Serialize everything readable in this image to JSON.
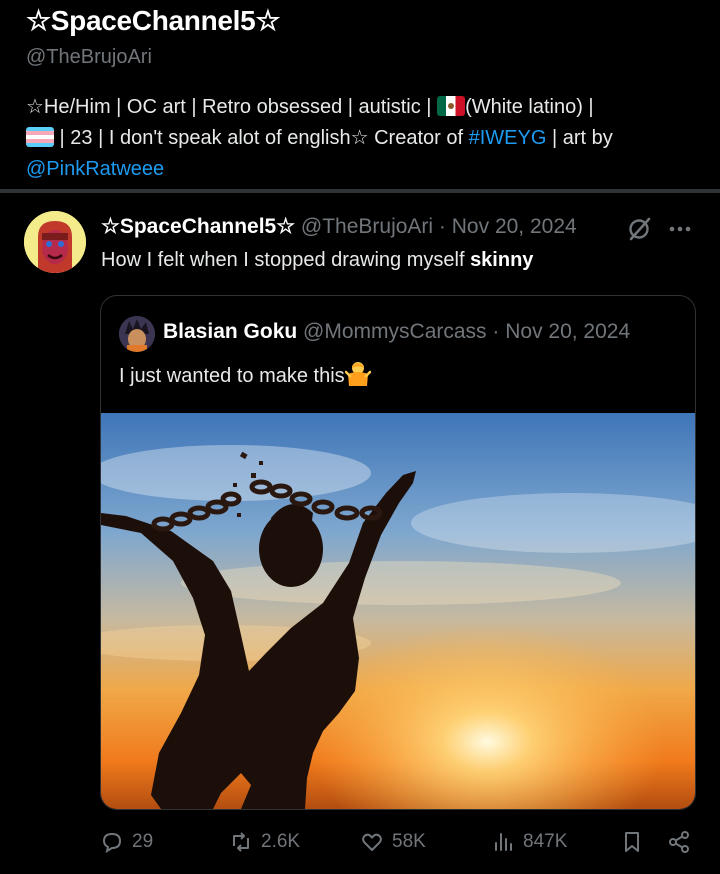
{
  "profile": {
    "display_name": "☆SpaceChannel5☆",
    "handle": "@TheBrujoAri",
    "bio_line1_a": "☆He/Him | OC art | Retro obsessed | autistic | ",
    "bio_line1_b": "(White latino) |",
    "bio_line2_a": " | 23 | I don't speak alot of english☆ Creator of ",
    "bio_hashtag": "#IWEYG",
    "bio_line2_b": " | art by",
    "bio_mention": "@PinkRatweee"
  },
  "tweet": {
    "author_name": "☆SpaceChannel5☆",
    "author_handle": "@TheBrujoAri",
    "separator": " · ",
    "date": "Nov 20, 2024",
    "text_plain": "How I felt when I stopped drawing myself ",
    "text_bold": "skinny"
  },
  "quoted": {
    "author_name": "Blasian Goku",
    "author_handle": "@MommysCarcass",
    "separator": " · ",
    "date": "Nov 20, 2024",
    "text": "I just wanted to make this"
  },
  "actions": {
    "replies": "29",
    "reposts": "2.6K",
    "likes": "58K",
    "views": "847K"
  },
  "icons": [
    "grok-icon",
    "more-icon",
    "reply-icon",
    "repost-icon",
    "like-icon",
    "views-icon",
    "bookmark-icon",
    "share-icon",
    "person-shrugging-icon",
    "mexico-flag-icon",
    "trans-flag-icon"
  ],
  "colors": {
    "background": "#000000",
    "text": "#e7e9ea",
    "muted": "#71767b",
    "link": "#1d9bf0",
    "border": "#2f3336"
  }
}
